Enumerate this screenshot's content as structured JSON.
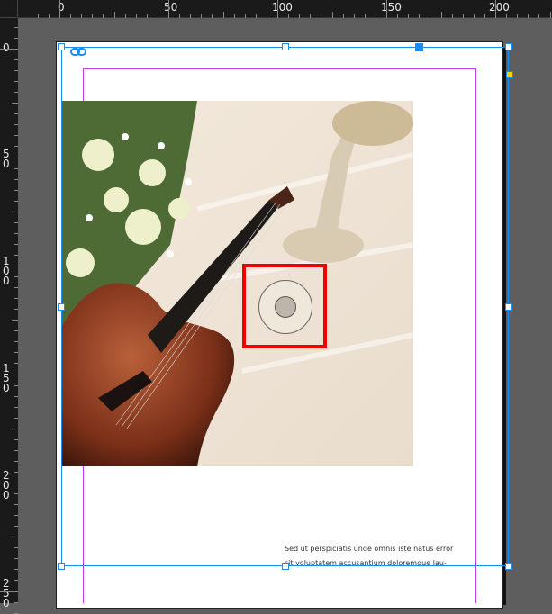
{
  "rulers": {
    "horizontal": [
      "0",
      "50",
      "100",
      "150",
      "200"
    ],
    "vertical": [
      "0",
      "50",
      "100",
      "150",
      "200",
      "250"
    ]
  },
  "text_frame": {
    "lines": [
      "Sed ut perspiciatis unde omnis iste natus error",
      "sit voluptatem accusantium doloremque lau-"
    ]
  },
  "colors": {
    "selection": "#1a8cf0",
    "margin_guide": "#c43cf2",
    "highlight": "#f20000"
  }
}
